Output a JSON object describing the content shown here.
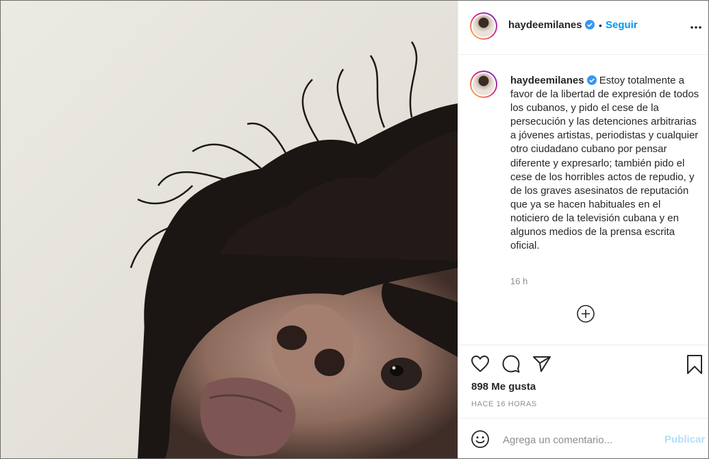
{
  "post": {
    "username": "haydeemilanes",
    "follow_dot": "•",
    "follow_label": "Seguir",
    "caption": "Estoy totalmente a favor de la libertad de expresión de todos los cubanos, y pido el cese de la persecución y las detenciones arbitrarias a jóvenes artistas, periodistas y cualquier otro ciudadano cubano por pensar diferente y expresarlo; también pido el cese de los horribles actos de repudio, y de los graves asesinatos de reputación que ya se hacen habituales en el noticiero de la televisión cubana y en algunos medios de la prensa escrita oficial.",
    "caption_time": "16 h",
    "likes": "898 Me gusta",
    "posted_ago": "HACE 16 HORAS"
  },
  "comment": {
    "placeholder": "Agrega un comentario...",
    "publish_label": "Publicar"
  },
  "icons": {
    "verified": "verified-badge-icon",
    "more": "more-options-icon",
    "load_more": "plus-circle-icon",
    "like": "heart-icon",
    "comment": "comment-icon",
    "share": "paper-plane-icon",
    "save": "bookmark-icon",
    "emoji": "emoji-icon"
  },
  "colors": {
    "accent": "#0095f6",
    "verified": "#3897f0",
    "publish_disabled": "#b2dffc",
    "secondary_text": "#8e8e8e"
  }
}
